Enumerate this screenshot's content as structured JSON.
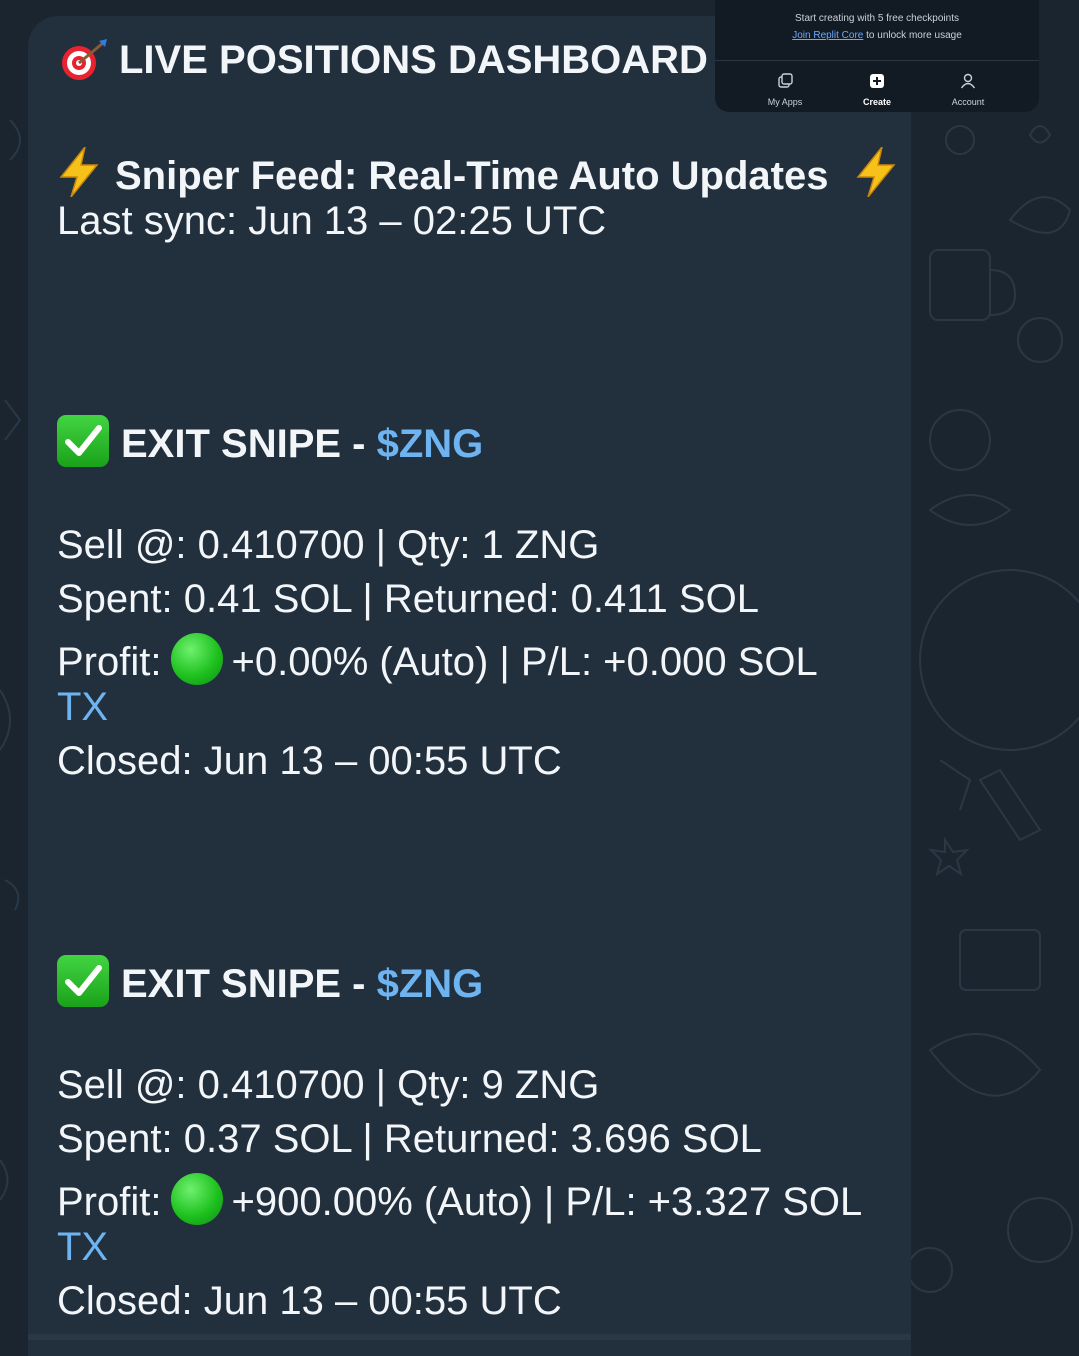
{
  "dashboard": {
    "title": "LIVE POSITIONS DASHBOARD",
    "feed_title": "Sniper Feed: Real-Time Auto Updates",
    "last_sync": "Last sync: Jun 13 – 02:25 UTC"
  },
  "trades": [
    {
      "heading": "EXIT SNIPE - ",
      "symbol": "$ZNG",
      "sell_line": "Sell @: 0.410700 | Qty: 1 ZNG",
      "spent_line": "Spent: 0.41 SOL | Returned: 0.411 SOL",
      "profit_label": "Profit:",
      "profit_value": "+0.00% (Auto) | P/L: +0.000 SOL",
      "tx_link": "TX",
      "closed_line": "Closed: Jun 13 – 00:55 UTC"
    },
    {
      "heading": "EXIT SNIPE - ",
      "symbol": "$ZNG",
      "sell_line": "Sell @: 0.410700 | Qty: 9 ZNG",
      "spent_line": "Spent: 0.37 SOL | Returned: 3.696 SOL",
      "profit_label": "Profit:",
      "profit_value": "+900.00% (Auto) | P/L: +3.327 SOL",
      "tx_link": "TX",
      "closed_line": "Closed: Jun 13 – 00:55 UTC"
    }
  ],
  "overlay": {
    "promo_line1": "Start creating with 5 free checkpoints",
    "promo_link": "Join Replit Core",
    "promo_rest": " to unlock more usage",
    "nav": [
      {
        "label": "My Apps",
        "icon": "my-apps-icon"
      },
      {
        "label": "Create",
        "icon": "create-plus-icon"
      },
      {
        "label": "Account",
        "icon": "account-icon"
      }
    ]
  },
  "colors": {
    "background": "#1a2530",
    "bubble": "#222f3d",
    "text": "#f3f6f9",
    "accent": "#6db4f1",
    "green_status": "#1fc21f"
  },
  "icons": [
    "target-dart-icon",
    "lightning-icon",
    "check-mark-icon",
    "green-circle-icon"
  ]
}
